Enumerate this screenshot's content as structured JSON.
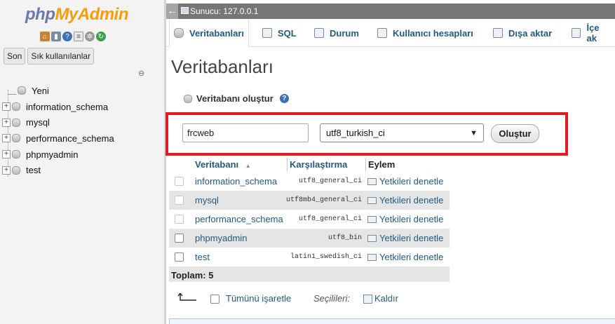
{
  "app": {
    "logo_php": "php",
    "logo_myadmin": "MyAdmin"
  },
  "sidebar": {
    "icons": [
      "home-icon",
      "logout-icon",
      "help-icon",
      "docs-icon",
      "settings-icon",
      "reload-icon"
    ],
    "btn_recent": "Son",
    "btn_favorites": "Sık kullanılanlar",
    "tree": [
      {
        "label": "Yeni",
        "expandable": false
      },
      {
        "label": "information_schema",
        "expandable": true
      },
      {
        "label": "mysql",
        "expandable": true
      },
      {
        "label": "performance_schema",
        "expandable": true
      },
      {
        "label": "phpmyadmin",
        "expandable": true
      },
      {
        "label": "test",
        "expandable": true
      }
    ]
  },
  "server_bar": {
    "collapse": "←",
    "label": "Sunucu: 127.0.0.1"
  },
  "tabs": [
    {
      "label": "Veritabanları",
      "active": true
    },
    {
      "label": "SQL",
      "active": false
    },
    {
      "label": "Durum",
      "active": false
    },
    {
      "label": "Kullanıcı hesapları",
      "active": false
    },
    {
      "label": "Dışa aktar",
      "active": false
    },
    {
      "label": "İçe ak",
      "active": false
    }
  ],
  "main": {
    "title": "Veritabanları",
    "create_label": "Veritabanı oluştur",
    "help_icon": "?",
    "new_db_value": "frcweb",
    "collation_value": "utf8_turkish_ci",
    "create_button": "Oluştur"
  },
  "table": {
    "headers": {
      "db": "Veritabanı",
      "sort_icon": "▲",
      "collation": "Karşılaştırma",
      "action": "Eylem"
    },
    "rows": [
      {
        "name": "information_schema",
        "collation": "utf8_general_ci",
        "action": "Yetkileri denetle",
        "checkbox_enabled": false
      },
      {
        "name": "mysql",
        "collation": "utf8mb4_general_ci",
        "action": "Yetkileri denetle",
        "checkbox_enabled": false
      },
      {
        "name": "performance_schema",
        "collation": "utf8_general_ci",
        "action": "Yetkileri denetle",
        "checkbox_enabled": false
      },
      {
        "name": "phpmyadmin",
        "collation": "utf8_bin",
        "action": "Yetkileri denetle",
        "checkbox_enabled": true
      },
      {
        "name": "test",
        "collation": "latin1_swedish_ci",
        "action": "Yetkileri denetle",
        "checkbox_enabled": true
      }
    ],
    "total": "Toplam: 5"
  },
  "bulk": {
    "check_all": "Tümünü işaretle",
    "with_selected": "Seçilileri:",
    "drop": "Kaldır"
  },
  "colors": {
    "link": "#235a81",
    "highlight_border": "#e41b23",
    "server_bar": "#767676"
  }
}
